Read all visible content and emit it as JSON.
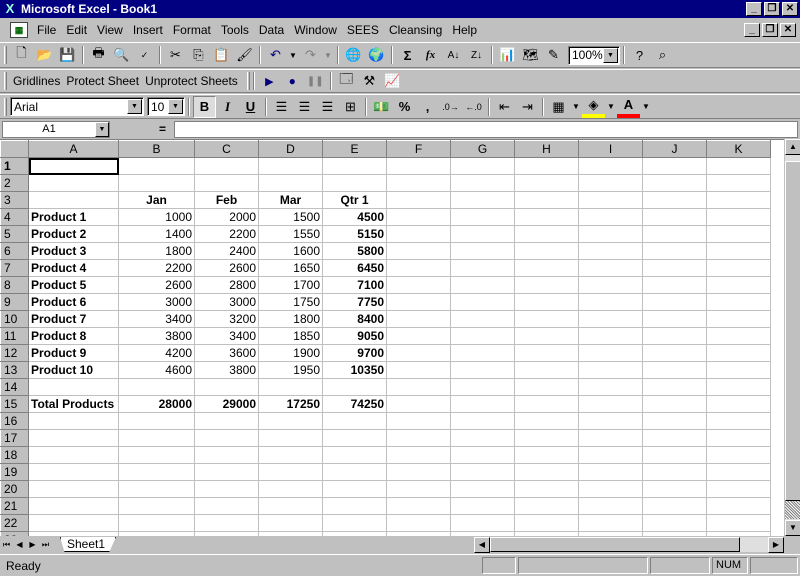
{
  "window": {
    "title": "Microsoft Excel - Book1"
  },
  "menu": [
    "File",
    "Edit",
    "View",
    "Insert",
    "Format",
    "Tools",
    "Data",
    "Window",
    "SEES",
    "Cleansing",
    "Help"
  ],
  "toolbar": {
    "zoom": "100%"
  },
  "toolbar2": {
    "gridlines": "Gridlines",
    "protect": "Protect Sheet",
    "unprotect": "Unprotect Sheets"
  },
  "format": {
    "font": "Arial",
    "size": "10",
    "bold": "B",
    "italic": "I",
    "underline": "U",
    "percent": "%",
    "comma": ","
  },
  "formula_bar": {
    "name_box": "A1",
    "equals": "="
  },
  "columns": [
    "A",
    "B",
    "C",
    "D",
    "E",
    "F",
    "G",
    "H",
    "I",
    "J",
    "K"
  ],
  "rows": [
    [
      "",
      "",
      "",
      "",
      ""
    ],
    [
      "",
      "",
      "",
      "",
      ""
    ],
    [
      "",
      "Jan",
      "Feb",
      "Mar",
      "Qtr 1"
    ],
    [
      "Product 1",
      "1000",
      "2000",
      "1500",
      "4500"
    ],
    [
      "Product 2",
      "1400",
      "2200",
      "1550",
      "5150"
    ],
    [
      "Product 3",
      "1800",
      "2400",
      "1600",
      "5800"
    ],
    [
      "Product 4",
      "2200",
      "2600",
      "1650",
      "6450"
    ],
    [
      "Product 5",
      "2600",
      "2800",
      "1700",
      "7100"
    ],
    [
      "Product 6",
      "3000",
      "3000",
      "1750",
      "7750"
    ],
    [
      "Product 7",
      "3400",
      "3200",
      "1800",
      "8400"
    ],
    [
      "Product 8",
      "3800",
      "3400",
      "1850",
      "9050"
    ],
    [
      "Product 9",
      "4200",
      "3600",
      "1900",
      "9700"
    ],
    [
      "Product 10",
      "4600",
      "3800",
      "1950",
      "10350"
    ],
    [
      "",
      "",
      "",
      "",
      ""
    ],
    [
      "Total Products",
      "28000",
      "29000",
      "17250",
      "74250"
    ],
    [
      "",
      "",
      "",
      "",
      ""
    ],
    [
      "",
      "",
      "",
      "",
      ""
    ],
    [
      "",
      "",
      "",
      "",
      ""
    ],
    [
      "",
      "",
      "",
      "",
      ""
    ],
    [
      "",
      "",
      "",
      "",
      ""
    ],
    [
      "",
      "",
      "",
      "",
      ""
    ],
    [
      "",
      "",
      "",
      "",
      ""
    ],
    [
      "",
      "",
      "",
      "",
      ""
    ]
  ],
  "sheet_tab": "Sheet1",
  "status": {
    "text": "Ready",
    "num": "NUM"
  }
}
